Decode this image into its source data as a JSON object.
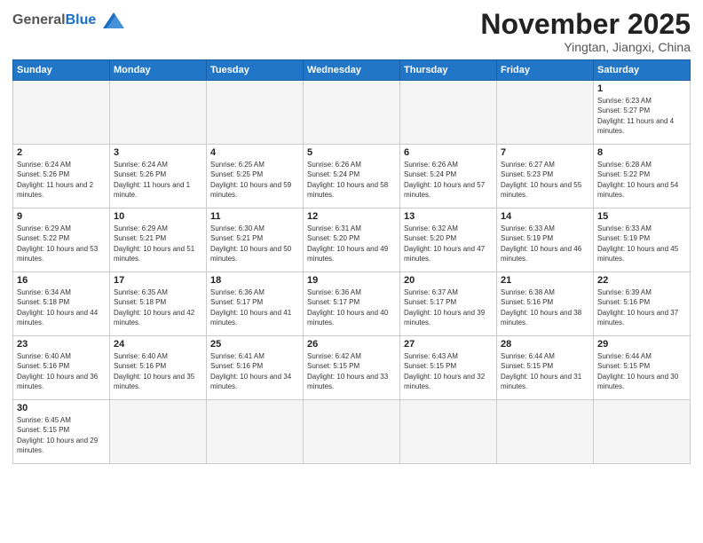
{
  "header": {
    "logo_general": "General",
    "logo_blue": "Blue",
    "month_title": "November 2025",
    "subtitle": "Yingtan, Jiangxi, China"
  },
  "weekdays": [
    "Sunday",
    "Monday",
    "Tuesday",
    "Wednesday",
    "Thursday",
    "Friday",
    "Saturday"
  ],
  "weeks": [
    [
      {
        "day": "",
        "empty": true
      },
      {
        "day": "",
        "empty": true
      },
      {
        "day": "",
        "empty": true
      },
      {
        "day": "",
        "empty": true
      },
      {
        "day": "",
        "empty": true
      },
      {
        "day": "",
        "empty": true
      },
      {
        "day": "1",
        "sunrise": "6:23 AM",
        "sunset": "5:27 PM",
        "daylight": "11 hours and 4 minutes."
      }
    ],
    [
      {
        "day": "2",
        "sunrise": "6:24 AM",
        "sunset": "5:26 PM",
        "daylight": "11 hours and 2 minutes."
      },
      {
        "day": "3",
        "sunrise": "6:24 AM",
        "sunset": "5:26 PM",
        "daylight": "11 hours and 1 minute."
      },
      {
        "day": "4",
        "sunrise": "6:25 AM",
        "sunset": "5:25 PM",
        "daylight": "10 hours and 59 minutes."
      },
      {
        "day": "5",
        "sunrise": "6:26 AM",
        "sunset": "5:24 PM",
        "daylight": "10 hours and 58 minutes."
      },
      {
        "day": "6",
        "sunrise": "6:26 AM",
        "sunset": "5:24 PM",
        "daylight": "10 hours and 57 minutes."
      },
      {
        "day": "7",
        "sunrise": "6:27 AM",
        "sunset": "5:23 PM",
        "daylight": "10 hours and 55 minutes."
      },
      {
        "day": "8",
        "sunrise": "6:28 AM",
        "sunset": "5:22 PM",
        "daylight": "10 hours and 54 minutes."
      }
    ],
    [
      {
        "day": "9",
        "sunrise": "6:29 AM",
        "sunset": "5:22 PM",
        "daylight": "10 hours and 53 minutes."
      },
      {
        "day": "10",
        "sunrise": "6:29 AM",
        "sunset": "5:21 PM",
        "daylight": "10 hours and 51 minutes."
      },
      {
        "day": "11",
        "sunrise": "6:30 AM",
        "sunset": "5:21 PM",
        "daylight": "10 hours and 50 minutes."
      },
      {
        "day": "12",
        "sunrise": "6:31 AM",
        "sunset": "5:20 PM",
        "daylight": "10 hours and 49 minutes."
      },
      {
        "day": "13",
        "sunrise": "6:32 AM",
        "sunset": "5:20 PM",
        "daylight": "10 hours and 47 minutes."
      },
      {
        "day": "14",
        "sunrise": "6:33 AM",
        "sunset": "5:19 PM",
        "daylight": "10 hours and 46 minutes."
      },
      {
        "day": "15",
        "sunrise": "6:33 AM",
        "sunset": "5:19 PM",
        "daylight": "10 hours and 45 minutes."
      }
    ],
    [
      {
        "day": "16",
        "sunrise": "6:34 AM",
        "sunset": "5:18 PM",
        "daylight": "10 hours and 44 minutes."
      },
      {
        "day": "17",
        "sunrise": "6:35 AM",
        "sunset": "5:18 PM",
        "daylight": "10 hours and 42 minutes."
      },
      {
        "day": "18",
        "sunrise": "6:36 AM",
        "sunset": "5:17 PM",
        "daylight": "10 hours and 41 minutes."
      },
      {
        "day": "19",
        "sunrise": "6:36 AM",
        "sunset": "5:17 PM",
        "daylight": "10 hours and 40 minutes."
      },
      {
        "day": "20",
        "sunrise": "6:37 AM",
        "sunset": "5:17 PM",
        "daylight": "10 hours and 39 minutes."
      },
      {
        "day": "21",
        "sunrise": "6:38 AM",
        "sunset": "5:16 PM",
        "daylight": "10 hours and 38 minutes."
      },
      {
        "day": "22",
        "sunrise": "6:39 AM",
        "sunset": "5:16 PM",
        "daylight": "10 hours and 37 minutes."
      }
    ],
    [
      {
        "day": "23",
        "sunrise": "6:40 AM",
        "sunset": "5:16 PM",
        "daylight": "10 hours and 36 minutes."
      },
      {
        "day": "24",
        "sunrise": "6:40 AM",
        "sunset": "5:16 PM",
        "daylight": "10 hours and 35 minutes."
      },
      {
        "day": "25",
        "sunrise": "6:41 AM",
        "sunset": "5:16 PM",
        "daylight": "10 hours and 34 minutes."
      },
      {
        "day": "26",
        "sunrise": "6:42 AM",
        "sunset": "5:15 PM",
        "daylight": "10 hours and 33 minutes."
      },
      {
        "day": "27",
        "sunrise": "6:43 AM",
        "sunset": "5:15 PM",
        "daylight": "10 hours and 32 minutes."
      },
      {
        "day": "28",
        "sunrise": "6:44 AM",
        "sunset": "5:15 PM",
        "daylight": "10 hours and 31 minutes."
      },
      {
        "day": "29",
        "sunrise": "6:44 AM",
        "sunset": "5:15 PM",
        "daylight": "10 hours and 30 minutes."
      }
    ],
    [
      {
        "day": "30",
        "sunrise": "6:45 AM",
        "sunset": "5:15 PM",
        "daylight": "10 hours and 29 minutes."
      },
      {
        "day": "",
        "empty": true
      },
      {
        "day": "",
        "empty": true
      },
      {
        "day": "",
        "empty": true
      },
      {
        "day": "",
        "empty": true
      },
      {
        "day": "",
        "empty": true
      },
      {
        "day": "",
        "empty": true
      }
    ]
  ]
}
